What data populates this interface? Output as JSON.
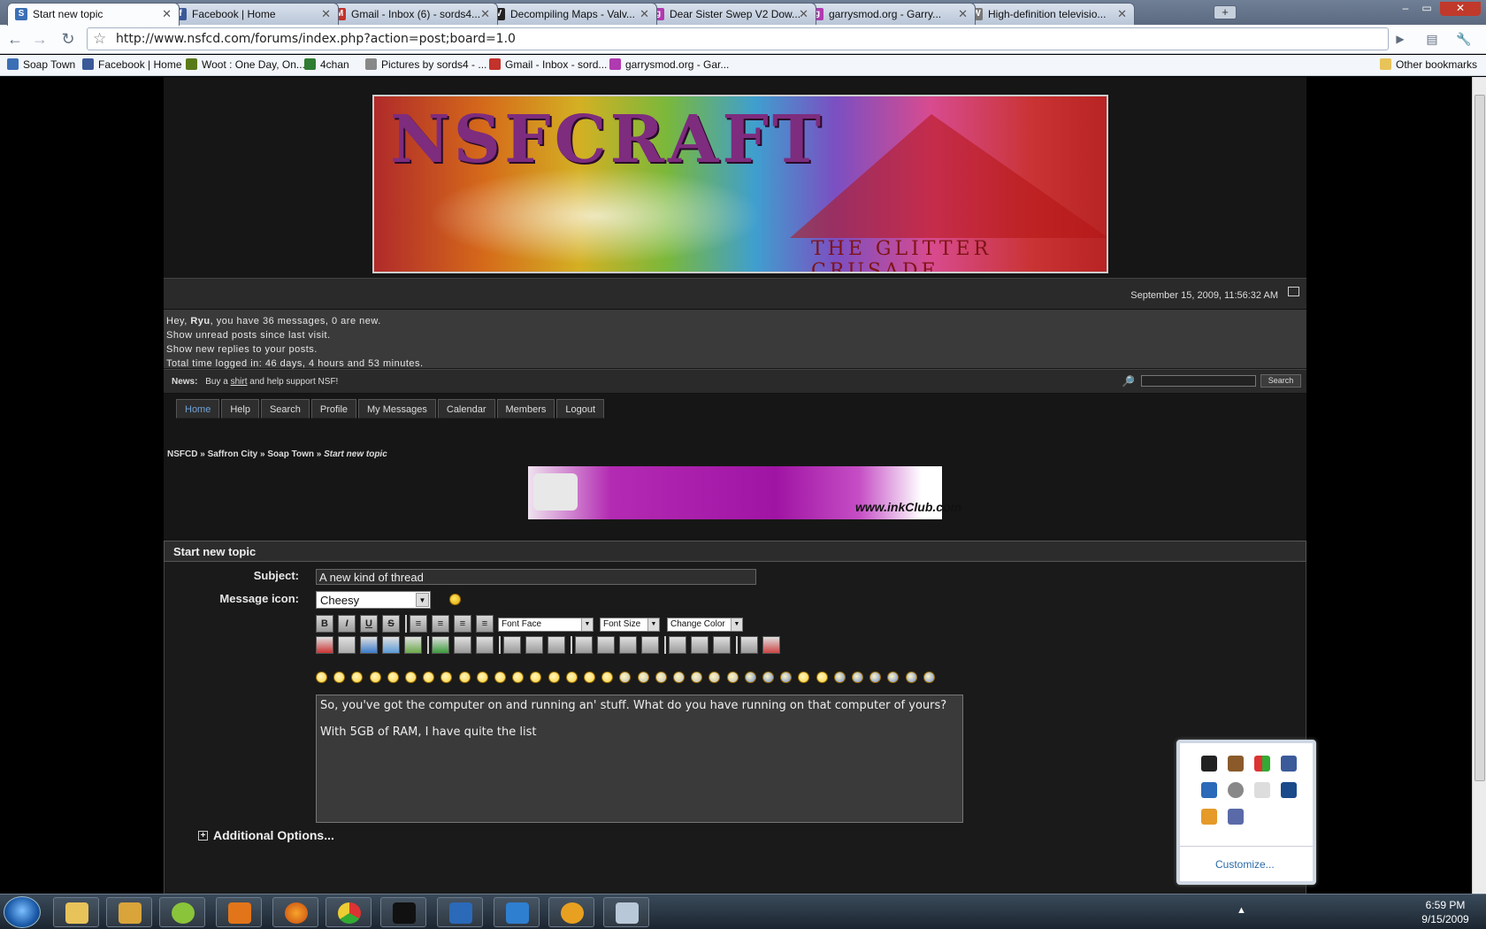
{
  "tabs": [
    {
      "title": "Start new topic",
      "color": "#3b6fb5",
      "glyph": "S"
    },
    {
      "title": "Facebook | Home",
      "color": "#3b5998",
      "glyph": "f"
    },
    {
      "title": "Gmail - Inbox (6) - sords4...",
      "color": "#c3322b",
      "glyph": "M"
    },
    {
      "title": "Decompiling Maps - Valv...",
      "color": "#222222",
      "glyph": "V"
    },
    {
      "title": "Dear Sister Swep V2 Dow...",
      "color": "#b03ab0",
      "glyph": "g"
    },
    {
      "title": "garrysmod.org - Garry...",
      "color": "#b03ab0",
      "glyph": "g"
    },
    {
      "title": "High-definition televisio...",
      "color": "#777777",
      "glyph": "W"
    }
  ],
  "toolbar": {
    "url": "http://www.nsfcd.com/forums/index.php?action=post;board=1.0"
  },
  "bookmarks": [
    {
      "label": "Soap Town",
      "color": "#3b6fb5"
    },
    {
      "label": "Facebook | Home",
      "color": "#3b5998"
    },
    {
      "label": "Woot : One Day, On...",
      "color": "#5a7a1a"
    },
    {
      "label": "4chan",
      "color": "#2e7d32"
    },
    {
      "label": "Pictures by sords4 - ...",
      "color": "#888888"
    },
    {
      "label": "Gmail - Inbox - sord...",
      "color": "#c3322b"
    },
    {
      "label": "garrysmod.org - Gar...",
      "color": "#b03ab0"
    }
  ],
  "other_bookmarks": "Other bookmarks",
  "banner": {
    "title": "NSFCRAFT",
    "subtitle": "THE GLITTER CRUSADE"
  },
  "datetime": "September 15, 2009, 11:56:32 AM",
  "userinfo": {
    "greeting_prefix": "Hey, ",
    "username": "Ryu",
    "greeting_suffix": ", you have 36 messages, 0 are new.",
    "line2": "Show unread posts since last visit.",
    "line3": "Show new replies to your posts.",
    "line4": "Total time logged in: 46 days, 4 hours and 53 minutes."
  },
  "news": {
    "label": "News:",
    "prefix": "Buy a",
    "link": "shirt",
    "suffix": "and help support NSF!",
    "search_button": "Search"
  },
  "menu": [
    "Home",
    "Help",
    "Search",
    "Profile",
    "My Messages",
    "Calendar",
    "Members",
    "Logout"
  ],
  "breadcrumb": {
    "items": [
      "NSFCD",
      "Saffron City",
      "Soap Town"
    ],
    "current": "Start new topic",
    "sep": " » "
  },
  "ad": {
    "logo": "www.inkClub.com"
  },
  "form": {
    "header": "Start new topic",
    "subject_label": "Subject:",
    "subject_value": "A new kind of thread",
    "icon_label": "Message icon:",
    "icon_value": "Cheesy",
    "font_face": "Font Face",
    "font_size": "Font Size",
    "change_color": "Change Color",
    "message": "So, you've got the computer on and running an' stuff. What do you have running on that computer of yours?\n\nWith 5GB of RAM, I have quite the list",
    "additional_options": "Additional Options..."
  },
  "tray_popup": {
    "customize": "Customize..."
  },
  "taskbar": {
    "time": "6:59 PM",
    "date": "9/15/2009"
  }
}
